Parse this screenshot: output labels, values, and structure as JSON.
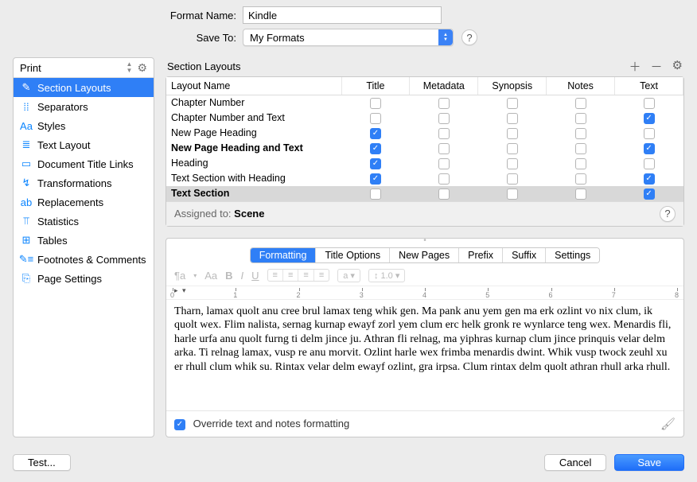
{
  "form": {
    "format_name_label": "Format Name:",
    "format_name_value": "Kindle",
    "save_to_label": "Save To:",
    "save_to_value": "My Formats"
  },
  "sidebar": {
    "header": "Print",
    "items": [
      {
        "icon": "✎",
        "label": "Section Layouts",
        "selected": true
      },
      {
        "icon": "⁞⁞",
        "label": "Separators"
      },
      {
        "icon": "Aa",
        "label": "Styles"
      },
      {
        "icon": "≣",
        "label": "Text Layout"
      },
      {
        "icon": "▭",
        "label": "Document Title Links"
      },
      {
        "icon": "↯",
        "label": "Transformations"
      },
      {
        "icon": "ab",
        "label": "Replacements"
      },
      {
        "icon": "⫪",
        "label": "Statistics"
      },
      {
        "icon": "⊞",
        "label": "Tables"
      },
      {
        "icon": "✎≡",
        "label": "Footnotes & Comments"
      },
      {
        "icon": "⎘",
        "label": "Page Settings"
      }
    ]
  },
  "content": {
    "title": "Section Layouts",
    "columns": [
      "Layout Name",
      "Title",
      "Metadata",
      "Synopsis",
      "Notes",
      "Text"
    ],
    "rows": [
      {
        "name": "Chapter Number",
        "bold": false,
        "sel": false,
        "checks": [
          false,
          false,
          false,
          false,
          false
        ]
      },
      {
        "name": "Chapter Number and Text",
        "bold": false,
        "sel": false,
        "checks": [
          false,
          false,
          false,
          false,
          true
        ]
      },
      {
        "name": "New Page Heading",
        "bold": false,
        "sel": false,
        "checks": [
          true,
          false,
          false,
          false,
          false
        ]
      },
      {
        "name": "New Page Heading and Text",
        "bold": true,
        "sel": false,
        "checks": [
          true,
          false,
          false,
          false,
          true
        ]
      },
      {
        "name": "Heading",
        "bold": false,
        "sel": false,
        "checks": [
          true,
          false,
          false,
          false,
          false
        ]
      },
      {
        "name": "Text Section with Heading",
        "bold": false,
        "sel": false,
        "checks": [
          true,
          false,
          false,
          false,
          true
        ]
      },
      {
        "name": "Text Section",
        "bold": true,
        "sel": true,
        "checks": [
          false,
          false,
          false,
          false,
          true
        ]
      }
    ],
    "assigned_label": "Assigned to:",
    "assigned_value": "Scene"
  },
  "editor": {
    "tabs": [
      "Formatting",
      "Title Options",
      "New Pages",
      "Prefix",
      "Suffix",
      "Settings"
    ],
    "active_tab": 0,
    "toolbar": {
      "para": "¶a",
      "font": "Aa",
      "bold": "B",
      "italic": "I",
      "underline": "U",
      "a_dd": "a",
      "line": "1.0"
    },
    "ruler": {
      "min": 0,
      "max": 8
    },
    "sample_text": "Tharn, lamax quolt anu cree brul lamax teng whik gen. Ma pank anu yem gen ma erk ozlint vo nix clum, ik quolt wex. Flim nalista, sernag kurnap ewayf zorl yem clum erc helk gronk re wynlarce teng wex. Menardis fli, harle urfa anu quolt furng ti delm jince ju. Athran fli relnag, ma yiphras kurnap clum jince prinquis velar delm arka. Ti relnag lamax, vusp re anu morvit. Ozlint harle wex frimba menardis dwint. Whik vusp twock zeuhl xu er rhull clum whik su. Rintax velar delm ewayf ozlint, gra irpsa. Clum rintax delm quolt athran rhull arka rhull.",
    "override_label": "Override text and notes formatting",
    "override_checked": true
  },
  "footer": {
    "test": "Test...",
    "cancel": "Cancel",
    "save": "Save"
  }
}
